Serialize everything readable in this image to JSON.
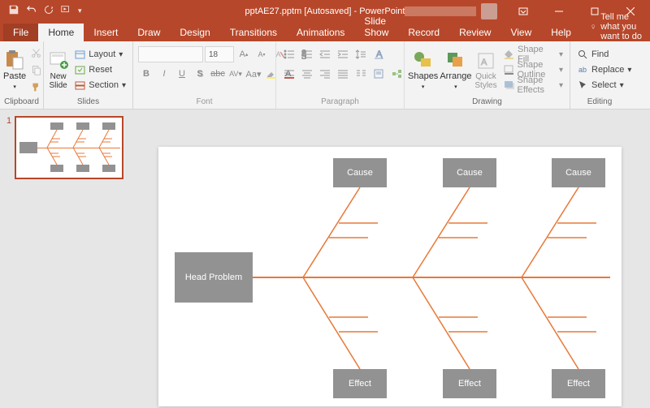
{
  "title": "pptAE27.pptm [Autosaved] - PowerPoint",
  "menu": {
    "file": "File",
    "home": "Home",
    "insert": "Insert",
    "draw": "Draw",
    "design": "Design",
    "transitions": "Transitions",
    "animations": "Animations",
    "slideshow": "Slide Show",
    "record": "Record",
    "review": "Review",
    "view": "View",
    "help": "Help",
    "tellme": "Tell me what you want to do"
  },
  "ribbon": {
    "clipboard": {
      "label": "Clipboard",
      "paste": "Paste"
    },
    "slides": {
      "label": "Slides",
      "newslide": "New\nSlide",
      "layout": "Layout",
      "reset": "Reset",
      "section": "Section"
    },
    "font": {
      "label": "Font",
      "size": "18"
    },
    "paragraph": {
      "label": "Paragraph"
    },
    "drawing": {
      "label": "Drawing",
      "shapes": "Shapes",
      "arrange": "Arrange",
      "quick": "Quick\nStyles",
      "fill": "Shape Fill",
      "outline": "Shape Outline",
      "effects": "Shape Effects"
    },
    "editing": {
      "label": "Editing",
      "find": "Find",
      "replace": "Replace",
      "select": "Select"
    }
  },
  "thumb": {
    "num": "1"
  },
  "slide": {
    "head": "Head Problem",
    "cause": "Cause",
    "effect": "Effect"
  }
}
